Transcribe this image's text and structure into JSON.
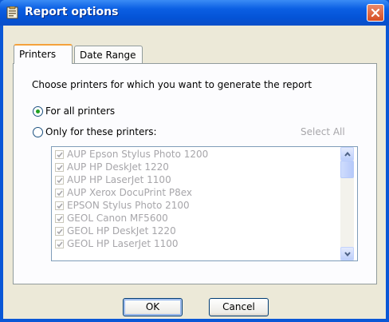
{
  "window": {
    "title": "Report options",
    "title_icon": "report-icon",
    "close_icon": "close-icon",
    "titlebar_color": "#0453d6",
    "close_color": "#d64d23"
  },
  "tabs": [
    {
      "label": "Printers",
      "active": true
    },
    {
      "label": "Date Range",
      "active": false
    }
  ],
  "printers_tab": {
    "description": "Choose printers for which you want to generate the report",
    "options": [
      {
        "label": "For all printers",
        "selected": true
      },
      {
        "label": "Only for these printers:",
        "selected": false
      }
    ],
    "select_all_label": "Select All",
    "select_all_enabled": false,
    "printer_list": {
      "enabled": false,
      "items": [
        {
          "label": "AUP Epson Stylus Photo 1200",
          "checked": true
        },
        {
          "label": "AUP HP DeskJet 1220",
          "checked": true
        },
        {
          "label": "AUP HP LaserJet 1100",
          "checked": true
        },
        {
          "label": "AUP Xerox DocuPrint P8ex",
          "checked": true
        },
        {
          "label": "EPSON Stylus Photo 2100",
          "checked": true
        },
        {
          "label": "GEOL Canon MF5600",
          "checked": true
        },
        {
          "label": "GEOL HP DeskJet 1220",
          "checked": true
        },
        {
          "label": "GEOL HP LaserJet 1100",
          "checked": true
        }
      ]
    }
  },
  "buttons": {
    "ok": "OK",
    "cancel": "Cancel"
  }
}
